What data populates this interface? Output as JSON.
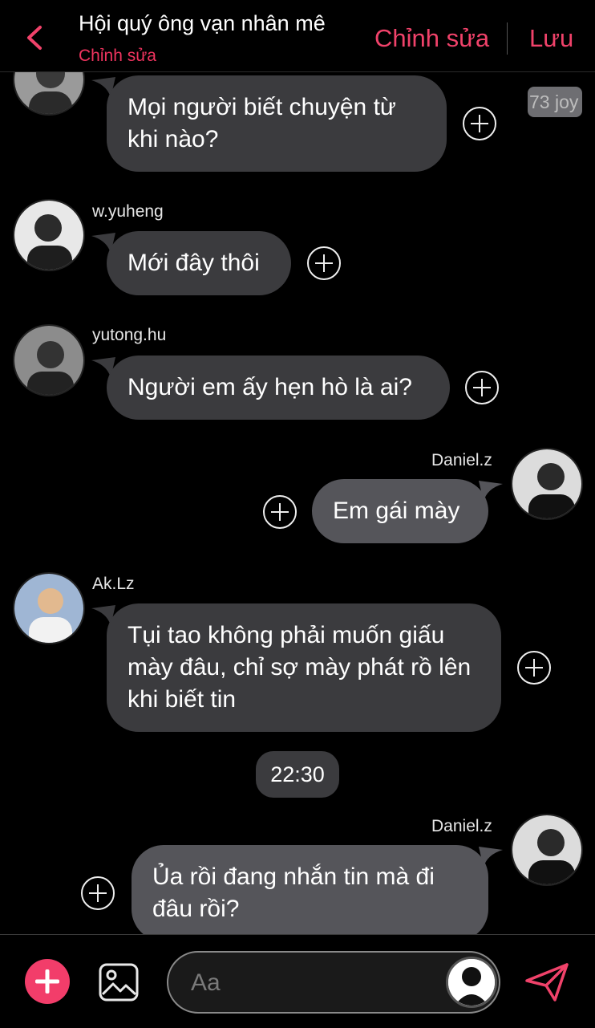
{
  "header": {
    "title": "Hội quý ông vạn nhân mê",
    "subtitle": "Chỉnh sửa",
    "edit_label": "Chỉnh sửa",
    "save_label": "Lưu"
  },
  "badge": "73 joy",
  "messages": [
    {
      "sender": "",
      "text": "Mọi người biết chuyện từ khi nào?",
      "side": "left"
    },
    {
      "sender": "w.yuheng",
      "text": "Mới đây thôi",
      "side": "left"
    },
    {
      "sender": "yutong.hu",
      "text": "Người em ấy hẹn hò là ai?",
      "side": "left"
    },
    {
      "sender": "Daniel.z",
      "text": "Em gái mày",
      "side": "right"
    },
    {
      "sender": "Ak.Lz",
      "text": "Tụi tao không phải muốn giấu mày đâu, chỉ sợ mày phát rồ lên khi biết tin",
      "side": "left"
    },
    {
      "sender": "Daniel.z",
      "text": "Ủa rồi đang nhắn tin mà đi đâu rồi?",
      "side": "right"
    }
  ],
  "timestamp": "22:30",
  "composer": {
    "placeholder": "Aa"
  },
  "colors": {
    "accent": "#f0426a",
    "bubble": "#3b3b3e",
    "bubble_right": "#55555a",
    "background": "#000000"
  },
  "icons": [
    "back-chevron-icon",
    "plus-circle-icon",
    "image-icon",
    "send-icon",
    "user-silhouette-icon"
  ]
}
